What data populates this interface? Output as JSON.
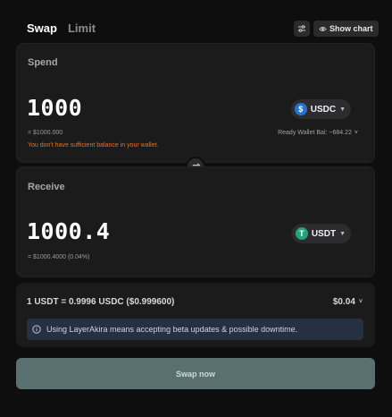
{
  "tabs": [
    {
      "label": "Swap"
    },
    {
      "label": "Limit"
    }
  ],
  "header": {
    "show_chart_label": "Show chart",
    "settings_icon": "sliders-icon",
    "chart_icon": "eye-icon"
  },
  "spend": {
    "title": "Spend",
    "amount": "1000",
    "token": "USDC",
    "fiat": "= $1000.000",
    "warning": "You don't have sufficient balance in your wallet.",
    "balance_label": "Ready Wallet Bal: ~684.22"
  },
  "receive": {
    "title": "Receive",
    "amount": "1000.4",
    "token": "USDT",
    "fiat": "= $1000.4000 (0.04%)"
  },
  "rate": {
    "text": "1 USDT = 0.9996 USDC ($0.999600)",
    "fee": "$0.04"
  },
  "notice": {
    "text": "Using LayerAkira means accepting beta updates & possible downtime."
  },
  "swap_button": {
    "label": "Swap now"
  },
  "colors": {
    "accent": "#5a6f70",
    "warning": "#e2742c",
    "usdc": "#2775ca",
    "usdt": "#26a17b"
  }
}
